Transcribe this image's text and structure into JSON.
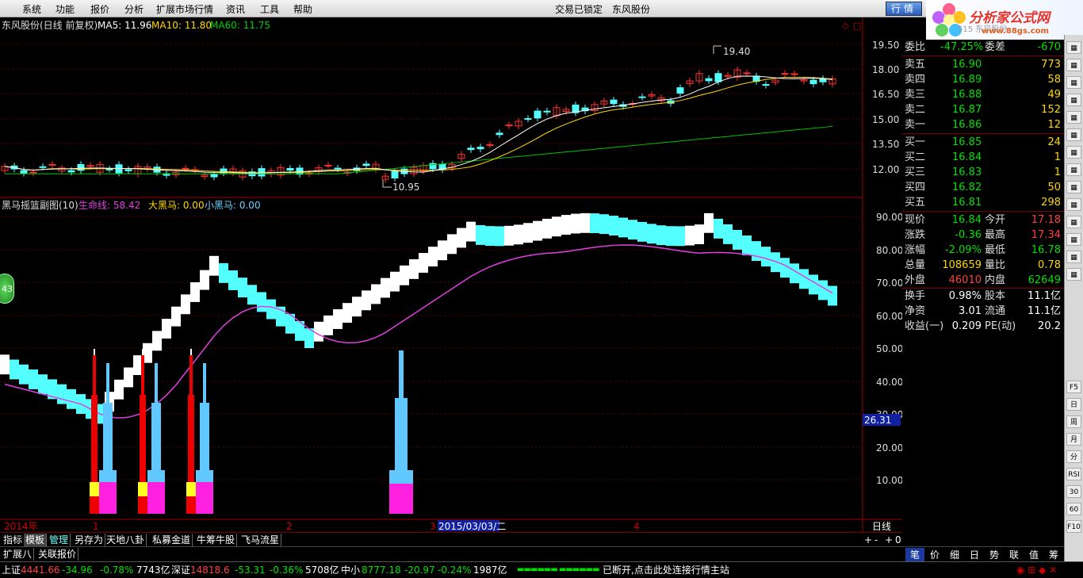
{
  "menu": {
    "items": [
      "系统",
      "功能",
      "报价",
      "分析",
      "扩展市场行情",
      "资讯",
      "工具",
      "帮助"
    ],
    "center": "交易已锁定",
    "stock": "东风股份",
    "hq_button": "行情"
  },
  "logo": {
    "title": "分析家公式网",
    "url": "www.88gs.com",
    "faded": "515 东风股份"
  },
  "main": {
    "title": "东风股份(日线 前复权)",
    "ma5": "MA5: 11.96",
    "ma10": "MA10: 11.80",
    "ma60": "MA60: 11.75",
    "high_label": "19.40",
    "low_label": "10.95",
    "yaxis": [
      "19.50",
      "18.00",
      "16.50",
      "15.00",
      "13.50",
      "12.00"
    ],
    "colors": {
      "up": "#ff3030",
      "down": "#54ffff",
      "ma5": "#ffffff",
      "ma10": "#ffd700",
      "ma60": "#00d000"
    }
  },
  "sub": {
    "title": "黑马摇篮副图(10)",
    "line1": "生命线: 58.42",
    "line2": "大黑马: 0.00",
    "line3": "小黑马: 0.00",
    "yaxis": [
      "90.00",
      "80.00",
      "70.00",
      "60.00",
      "50.00",
      "40.00",
      "30.00",
      "20.00",
      "10.00"
    ],
    "cursor_value": "26.31",
    "badge": "43"
  },
  "timeaxis": {
    "labels": [
      "2014年",
      "1",
      "2",
      "3",
      "4"
    ],
    "cursor_date": "2015/03/03/二",
    "period": "日线"
  },
  "quote": {
    "weibi": {
      "label": "委比",
      "value": "-47.25%",
      "label2": "委差",
      "value2": "-670"
    },
    "sell": [
      {
        "label": "卖五",
        "price": "16.90",
        "vol": "773"
      },
      {
        "label": "卖四",
        "price": "16.89",
        "vol": "58"
      },
      {
        "label": "卖三",
        "price": "16.88",
        "vol": "49"
      },
      {
        "label": "卖二",
        "price": "16.87",
        "vol": "152"
      },
      {
        "label": "卖一",
        "price": "16.86",
        "vol": "12"
      }
    ],
    "buy": [
      {
        "label": "买一",
        "price": "16.85",
        "vol": "24"
      },
      {
        "label": "买二",
        "price": "16.84",
        "vol": "1"
      },
      {
        "label": "买三",
        "price": "16.83",
        "vol": "1"
      },
      {
        "label": "买四",
        "price": "16.82",
        "vol": "50"
      },
      {
        "label": "买五",
        "price": "16.81",
        "vol": "298"
      }
    ],
    "stats": [
      {
        "l1": "现价",
        "v1": "16.84",
        "l2": "今开",
        "v2": "17.18",
        "c1": "grn",
        "c2": "red"
      },
      {
        "l1": "涨跌",
        "v1": "-0.36",
        "l2": "最高",
        "v2": "17.34",
        "c1": "grn",
        "c2": "red"
      },
      {
        "l1": "涨幅",
        "v1": "-2.09%",
        "l2": "最低",
        "v2": "16.78",
        "c1": "grn",
        "c2": "grn"
      },
      {
        "l1": "总量",
        "v1": "108659",
        "l2": "量比",
        "v2": "0.78",
        "c1": "yel",
        "c2": "yel"
      },
      {
        "l1": "外盘",
        "v1": "46010",
        "l2": "内盘",
        "v2": "62649",
        "c1": "red",
        "c2": "grn"
      }
    ],
    "stats2": [
      {
        "l1": "换手",
        "v1": "0.98%",
        "l2": "股本",
        "v2": "11.1亿"
      },
      {
        "l1": "净资",
        "v1": "3.01",
        "l2": "流通",
        "v2": "11.1亿"
      },
      {
        "l1": "收益(一)",
        "v1": "0.209",
        "l2": "PE(动)",
        "v2": "20.2"
      }
    ]
  },
  "tabs": {
    "row1": [
      "指标",
      "模板",
      "管理",
      "另存为",
      "天地八卦",
      "私募金道",
      "牛筹牛股",
      "飞马流星"
    ],
    "row2": [
      "扩展八",
      "关联报价"
    ],
    "right": [
      "笔",
      "价",
      "细",
      "日",
      "势",
      "联",
      "值",
      "筹"
    ],
    "ctrl": [
      "+",
      "-",
      "+",
      "0"
    ]
  },
  "sidetools": [
    "F5",
    "日",
    "周",
    "月",
    "分",
    "RSI",
    "30",
    "60",
    "F10"
  ],
  "status": {
    "sh_label": "上证",
    "sh_val": "4441.66",
    "sh_chg": "-34.96",
    "sh_pct": "-0.78%",
    "sh_amt": "7743亿",
    "sz_label": "深证",
    "sz_val": "14818.6",
    "sz_chg": "-53.31",
    "sz_pct": "-0.36%",
    "sz_amt": "5708亿",
    "zx_label": "中小",
    "zx_val": "8777.18",
    "zx_chg": "-20.97",
    "zx_pct": "-0.24%",
    "zx_amt": "1987亿",
    "msg": "已断开,点击此处连接行情主站"
  }
}
